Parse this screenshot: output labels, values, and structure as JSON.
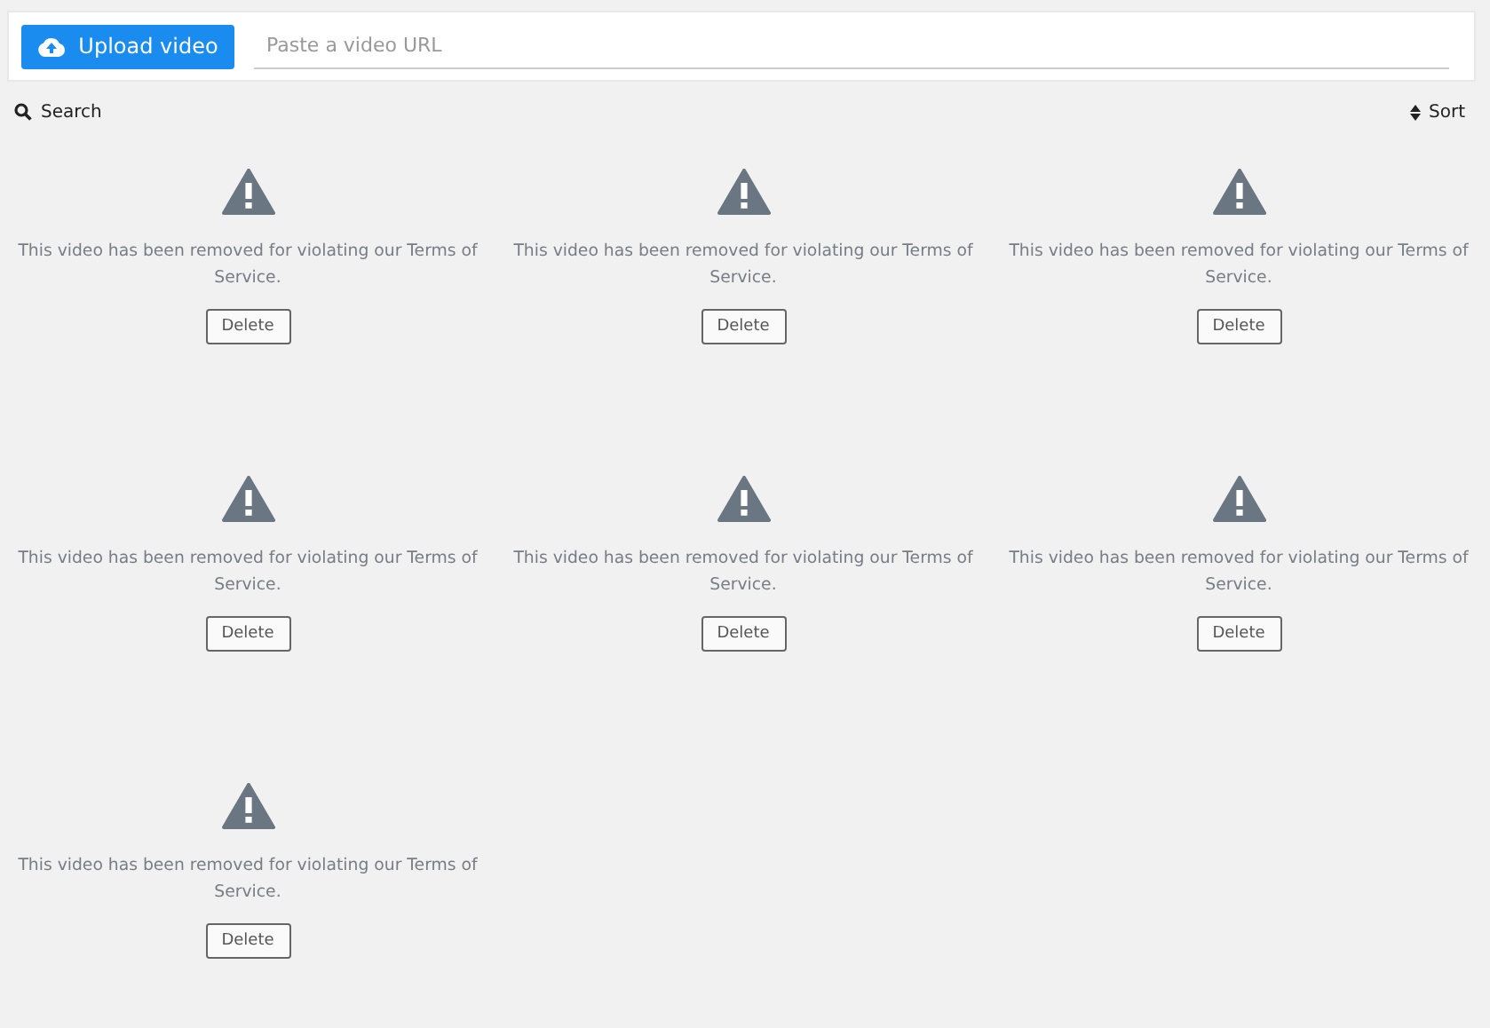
{
  "toolbar": {
    "upload_button": "Upload video",
    "url_field": {
      "placeholder": "Paste a video URL"
    }
  },
  "search": "Search",
  "sort": "Sort",
  "videos": [
    {
      "message": "This video has been removed for violating our Terms of Service.",
      "button": "Delete"
    },
    {
      "message": "This video has been removed for violating our Terms of Service.",
      "button": "Delete"
    },
    {
      "message": "This video has been removed for violating our Terms of Service.",
      "button": "Delete"
    },
    {
      "message": "This video has been removed for violating our Terms of Service.",
      "button": "Delete"
    },
    {
      "message": "This video has been removed for violating our Terms of Service.",
      "button": "Delete"
    },
    {
      "message": "This video has been removed for violating our Terms of Service.",
      "button": "Delete"
    },
    {
      "message": "This video has been removed for violating our Terms of Service.",
      "button": "Delete"
    }
  ]
}
